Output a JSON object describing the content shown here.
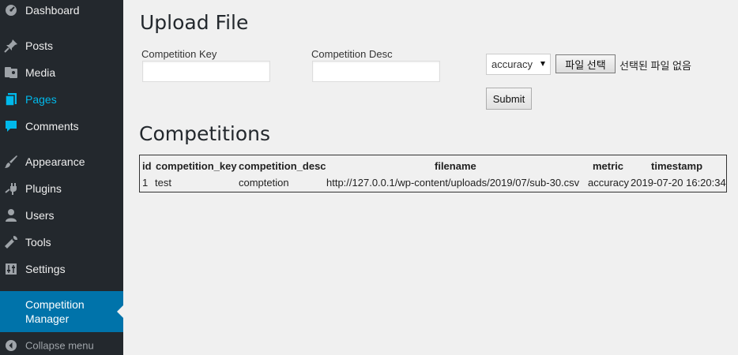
{
  "sidebar": {
    "items": [
      {
        "label": "Dashboard"
      },
      {
        "label": "Posts"
      },
      {
        "label": "Media"
      },
      {
        "label": "Pages"
      },
      {
        "label": "Comments"
      },
      {
        "label": "Appearance"
      },
      {
        "label": "Plugins"
      },
      {
        "label": "Users"
      },
      {
        "label": "Tools"
      },
      {
        "label": "Settings"
      },
      {
        "label": "Competition Manager"
      },
      {
        "label": "Collapse menu"
      }
    ],
    "colors": {
      "background": "#23282d",
      "active": "#0073aa",
      "current_text": "#00b9eb"
    }
  },
  "upload": {
    "title": "Upload File",
    "key_label": "Competition Key",
    "key_value": "",
    "desc_label": "Competition Desc",
    "desc_value": "",
    "metric_selected": "accuracy",
    "file_button": "파일 선택",
    "file_status": "선택된 파일 없음",
    "submit": "Submit"
  },
  "competitions": {
    "title": "Competitions",
    "columns": [
      "id",
      "competition_key",
      "competition_desc",
      "filename",
      "metric",
      "timestamp"
    ],
    "rows": [
      [
        "1",
        "test",
        "comptetion",
        "http://127.0.0.1/wp-content/uploads/2019/07/sub-30.csv",
        "accuracy",
        "2019-07-20 16:20:34"
      ]
    ]
  }
}
